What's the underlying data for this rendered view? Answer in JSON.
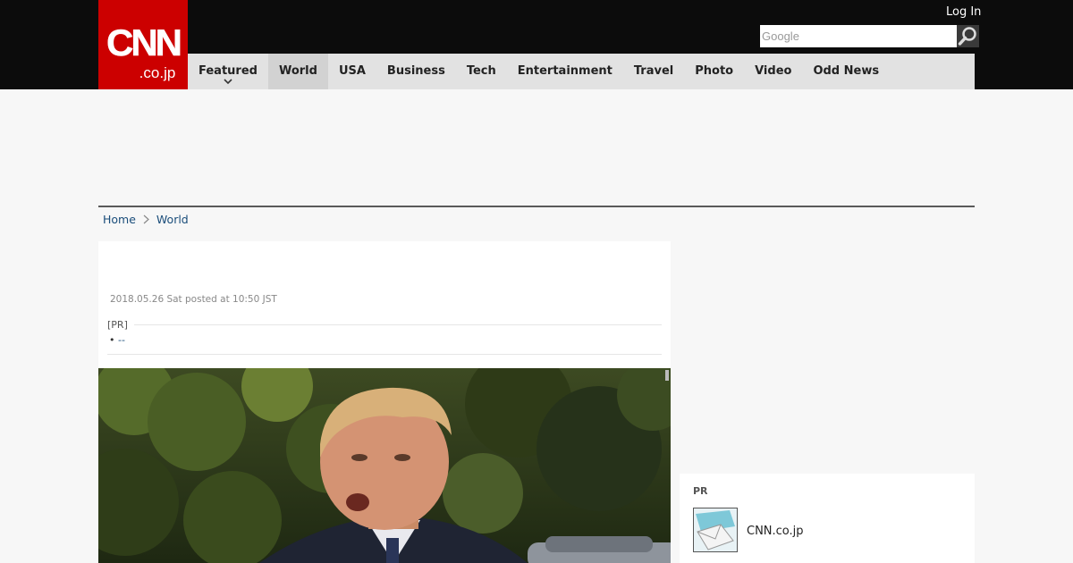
{
  "header": {
    "logo": {
      "line1": "CNN",
      "line2": ".co.jp"
    },
    "login_label": "Log In",
    "search": {
      "placeholder": "Google",
      "value": ""
    }
  },
  "nav": {
    "items": [
      {
        "label": "Featured",
        "has_dropdown": true
      },
      {
        "label": "World",
        "active": true
      },
      {
        "label": "USA"
      },
      {
        "label": "Business"
      },
      {
        "label": "Tech"
      },
      {
        "label": "Entertainment"
      },
      {
        "label": "Travel"
      },
      {
        "label": "Photo"
      },
      {
        "label": "Video"
      },
      {
        "label": "Odd News"
      }
    ]
  },
  "breadcrumb": {
    "home": "Home",
    "current": "World"
  },
  "article": {
    "posted": "2018.05.26 Sat posted at 10:50 JST",
    "pr_label": "[PR]",
    "pr_bullet": "•",
    "pr_link": "--"
  },
  "sidebar": {
    "pr_label": "PR",
    "pr_item": "CNN.co.jp"
  },
  "colors": {
    "brand_red": "#cc0000",
    "topbar": "#0c0c0c",
    "nav_bg": "#e2e2e2",
    "link": "#1a4d7a"
  }
}
